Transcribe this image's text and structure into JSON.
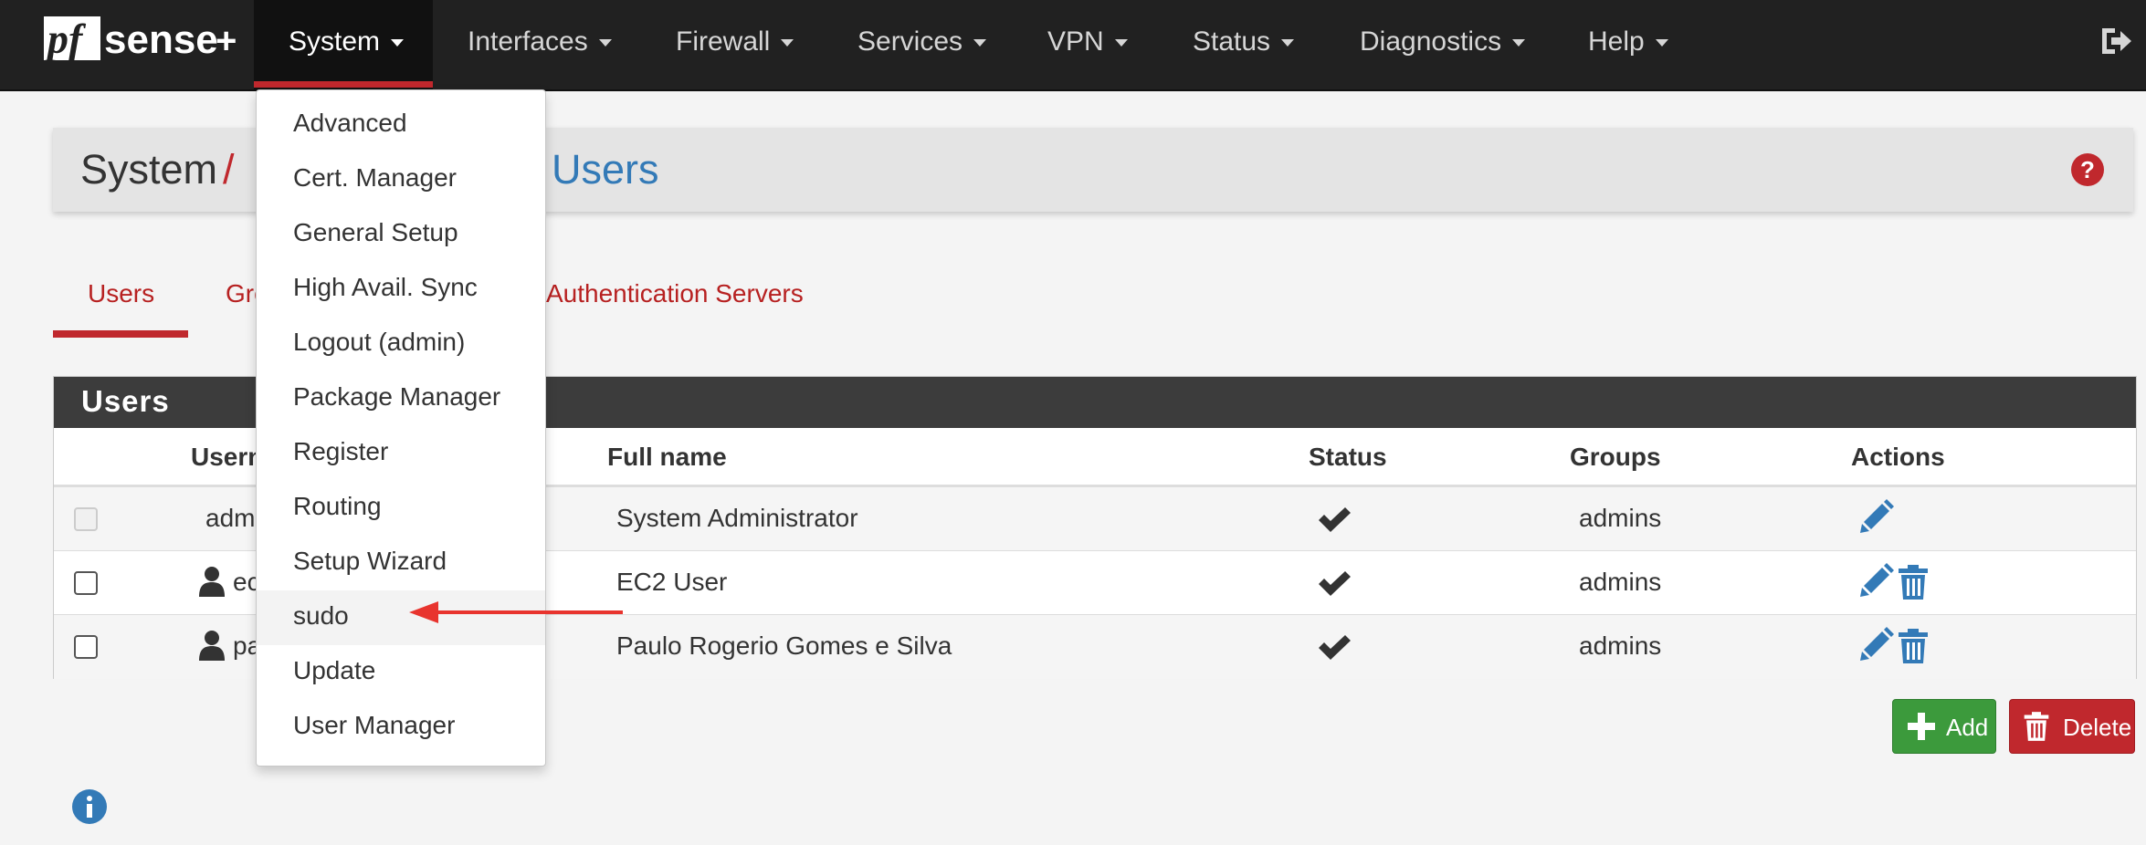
{
  "navbar": {
    "brand": "pfsense+",
    "items": [
      {
        "label": "System"
      },
      {
        "label": "Interfaces"
      },
      {
        "label": "Firewall"
      },
      {
        "label": "Services"
      },
      {
        "label": "VPN"
      },
      {
        "label": "Status"
      },
      {
        "label": "Diagnostics"
      },
      {
        "label": "Help"
      }
    ],
    "active": "System",
    "logout_icon": "logout-icon"
  },
  "breadcrumb": {
    "root": "System",
    "separator": "/",
    "page": "Users"
  },
  "tabs": [
    {
      "label": "Users",
      "active": true
    },
    {
      "label": "Gro"
    },
    {
      "label": "Authentication Servers"
    }
  ],
  "panel": {
    "title": "Users",
    "columns": [
      "Usern",
      "Full name",
      "Status",
      "Groups",
      "Actions"
    ],
    "rows": [
      {
        "username": "adm",
        "fullname": "System Administrator",
        "status": "enabled",
        "groups": "admins",
        "checkbox_enabled": false,
        "deletable": false
      },
      {
        "username": "ec",
        "fullname": "EC2 User",
        "status": "enabled",
        "groups": "admins",
        "checkbox_enabled": true,
        "deletable": true
      },
      {
        "username": "pa",
        "fullname": "Paulo Rogerio Gomes e Silva",
        "status": "enabled",
        "groups": "admins",
        "checkbox_enabled": true,
        "deletable": true
      }
    ]
  },
  "buttons": {
    "add": "Add",
    "delete": "Delete"
  },
  "dropdown": {
    "items": [
      {
        "label": "Advanced"
      },
      {
        "label": "Cert. Manager"
      },
      {
        "label": "General Setup"
      },
      {
        "label": "High Avail. Sync"
      },
      {
        "label": "Logout (admin)"
      },
      {
        "label": "Package Manager"
      },
      {
        "label": "Register"
      },
      {
        "label": "Routing"
      },
      {
        "label": "Setup Wizard"
      },
      {
        "label": "sudo"
      },
      {
        "label": "Update"
      },
      {
        "label": "User Manager"
      }
    ],
    "highlighted": "sudo"
  },
  "colors": {
    "navbar_bg": "#212121",
    "accent_red": "#c0282d",
    "link_blue": "#337ab7",
    "success_green": "#3c9a3c",
    "annotation_arrow": "#e8342e"
  }
}
